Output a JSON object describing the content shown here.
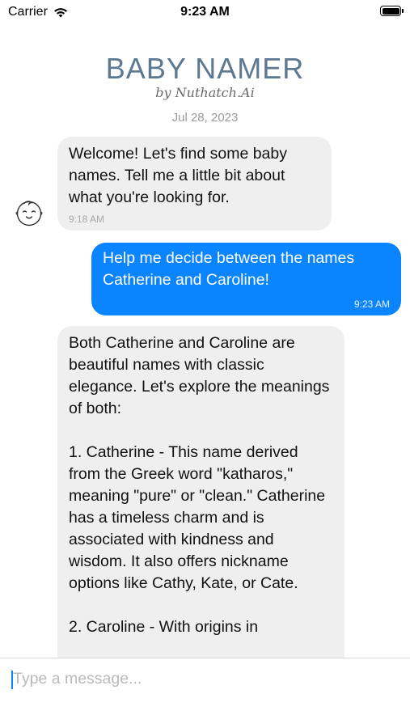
{
  "status_bar": {
    "carrier": "Carrier",
    "time": "9:23 AM"
  },
  "header": {
    "title": "BABY NAMER",
    "subtitle": "by Nuthatch.Ai",
    "date": "Jul 28, 2023"
  },
  "messages": [
    {
      "sender": "bot",
      "text": "Welcome! Let's find some baby names. Tell me a little bit about what you're looking for.",
      "time": "9:18 AM"
    },
    {
      "sender": "user",
      "text": "Help me decide between the names Catherine and Caroline!",
      "time": "9:23 AM"
    },
    {
      "sender": "bot",
      "text": "Both Catherine and Caroline are beautiful names with classic elegance. Let's explore the meanings of both:\n\n1. Catherine - This name derived from the Greek word \"katharos,\" meaning \"pure\" or \"clean.\" Catherine has a timeless charm and is associated with kindness and wisdom. It also offers nickname options like Cathy, Kate, or Cate.\n\n2. Caroline - With origins in"
    }
  ],
  "icons": {
    "avatar": "baby-face-icon",
    "wifi": "wifi-icon",
    "battery": "battery-icon"
  },
  "colors": {
    "title": "#5d7891",
    "outgoing_bubble": "#0a84ff",
    "incoming_bubble": "#efeff0"
  },
  "input": {
    "placeholder": "Type a message..."
  }
}
